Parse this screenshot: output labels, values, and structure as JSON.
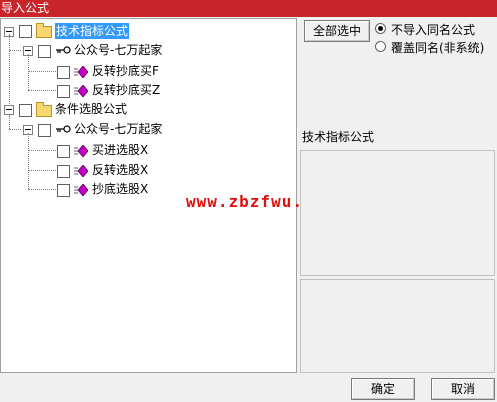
{
  "window": {
    "title": "导入公式"
  },
  "tree": {
    "root1": {
      "label": "技术指标公式"
    },
    "child1": {
      "label": "公众号-七万起家"
    },
    "items1": [
      "反转抄底买F",
      "反转抄底买Z"
    ],
    "root2": {
      "label": "条件选股公式"
    },
    "child2": {
      "label": "公众号-七万起家"
    },
    "items2": [
      "买进选股X",
      "反转选股X",
      "抄底选股X"
    ]
  },
  "side": {
    "select_all_label": "全部选中",
    "radio1_label": "不导入同名公式",
    "radio2_label": "覆盖同名(非系统)",
    "type_label": "技术指标公式"
  },
  "watermark": "www.zbzfwu.com",
  "footer": {
    "ok_label": "确定",
    "cancel_label": "取消"
  },
  "colors": {
    "titlebar": "#c8252b",
    "selection": "#3399ff",
    "watermark": "#e01010"
  }
}
